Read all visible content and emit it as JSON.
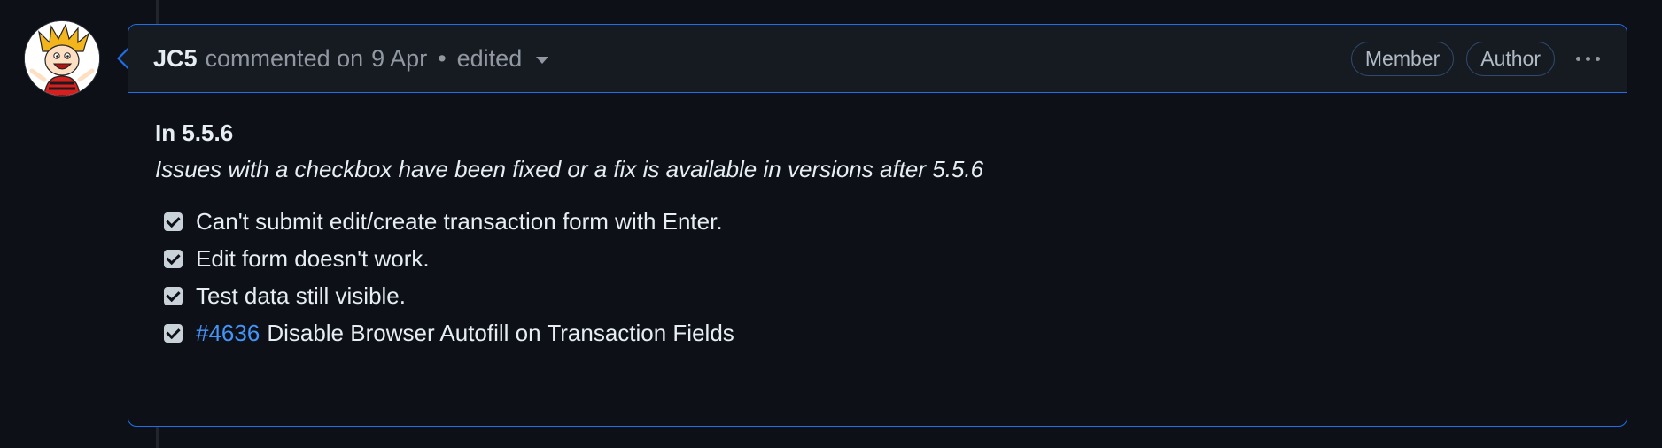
{
  "comment": {
    "author": "JC5",
    "action": "commented on",
    "date": "9 Apr",
    "separator": "•",
    "edited_label": "edited",
    "badges": [
      "Member",
      "Author"
    ],
    "menu_icon": "kebab-horizontal-icon",
    "avatar_icon": "cartoon-avatar",
    "body": {
      "heading": "In 5.5.6",
      "subtitle": "Issues with a checkbox have been fixed or a fix is available in versions after 5.5.6",
      "tasks": [
        {
          "checked": true,
          "link": "",
          "text": "Can't submit edit/create transaction form with Enter."
        },
        {
          "checked": true,
          "link": "",
          "text": "Edit form doesn't work."
        },
        {
          "checked": true,
          "link": "",
          "text": "Test data still visible."
        },
        {
          "checked": true,
          "link": "#4636",
          "text": "Disable Browser Autofill on Transaction Fields"
        }
      ]
    }
  },
  "colors": {
    "background": "#0d1117",
    "header_bg": "#161b22",
    "accent_border": "#1f6feb",
    "link": "#4493f8"
  }
}
